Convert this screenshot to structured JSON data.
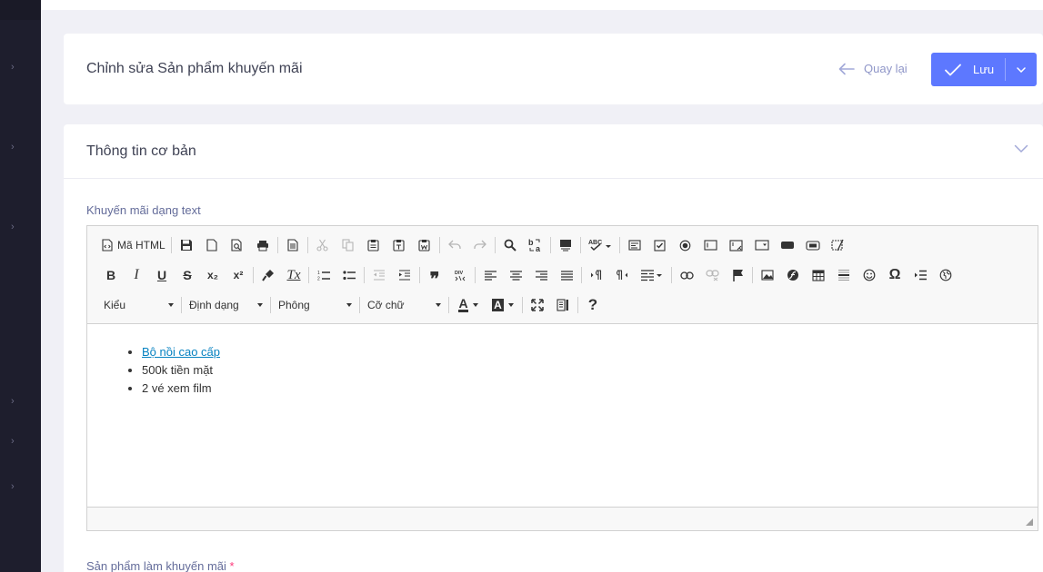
{
  "header": {
    "title": "Chỉnh sửa Sản phẩm khuyến mãi",
    "back_label": "Quay lại",
    "save_label": "Lưu"
  },
  "section": {
    "title": "Thông tin cơ bản",
    "promo_text_label": "Khuyến mãi dạng text",
    "products_label": "Sản phẩm làm khuyến mãi",
    "required_mark": "*"
  },
  "editor": {
    "source_label": "Mã HTML",
    "combos": [
      {
        "label": "Kiểu"
      },
      {
        "label": "Định dạng"
      },
      {
        "label": "Phông"
      },
      {
        "label": "Cỡ chữ"
      }
    ],
    "items": [
      {
        "text": "Bộ nồi cao cấp",
        "link": true
      },
      {
        "text": "500k tiền mặt",
        "link": false
      },
      {
        "text": "2 vé xem film",
        "link": false
      }
    ],
    "glyphs": {
      "bold": "B",
      "italic": "I",
      "underline": "U",
      "strike": "S",
      "subscript": "x₂",
      "superscript": "x²",
      "remove_format": "Tx",
      "blockquote": "❞",
      "special_char": "Ω",
      "help": "?",
      "text_color": "A",
      "bg_color": "A"
    }
  },
  "colors": {
    "accent": "#5d78ff",
    "sidebar": "#1e1e2d",
    "link": "#0782c1",
    "required": "#fd397a"
  }
}
